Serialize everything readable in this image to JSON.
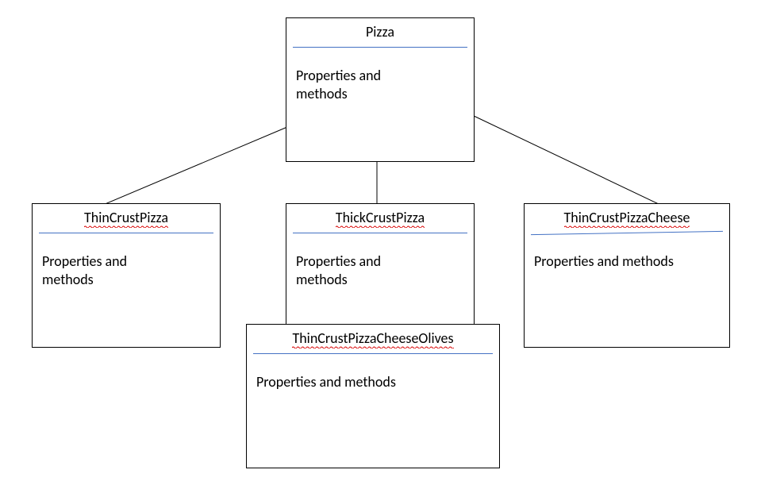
{
  "boxes": {
    "pizza": {
      "title": "Pizza",
      "body_line1": "Properties and",
      "body_line2": "methods"
    },
    "thin": {
      "title": "ThinCrustPizza",
      "body_line1": "Properties and",
      "body_line2": "methods"
    },
    "thick": {
      "title": "ThickCrustPizza",
      "body_line1": "Properties and",
      "body_line2": "methods"
    },
    "cheese": {
      "title": "ThinCrustPizzaCheese",
      "body": "Properties and methods"
    },
    "olives": {
      "title": "ThinCrustPizzaCheeseOlives",
      "body": "Properties and methods"
    }
  }
}
